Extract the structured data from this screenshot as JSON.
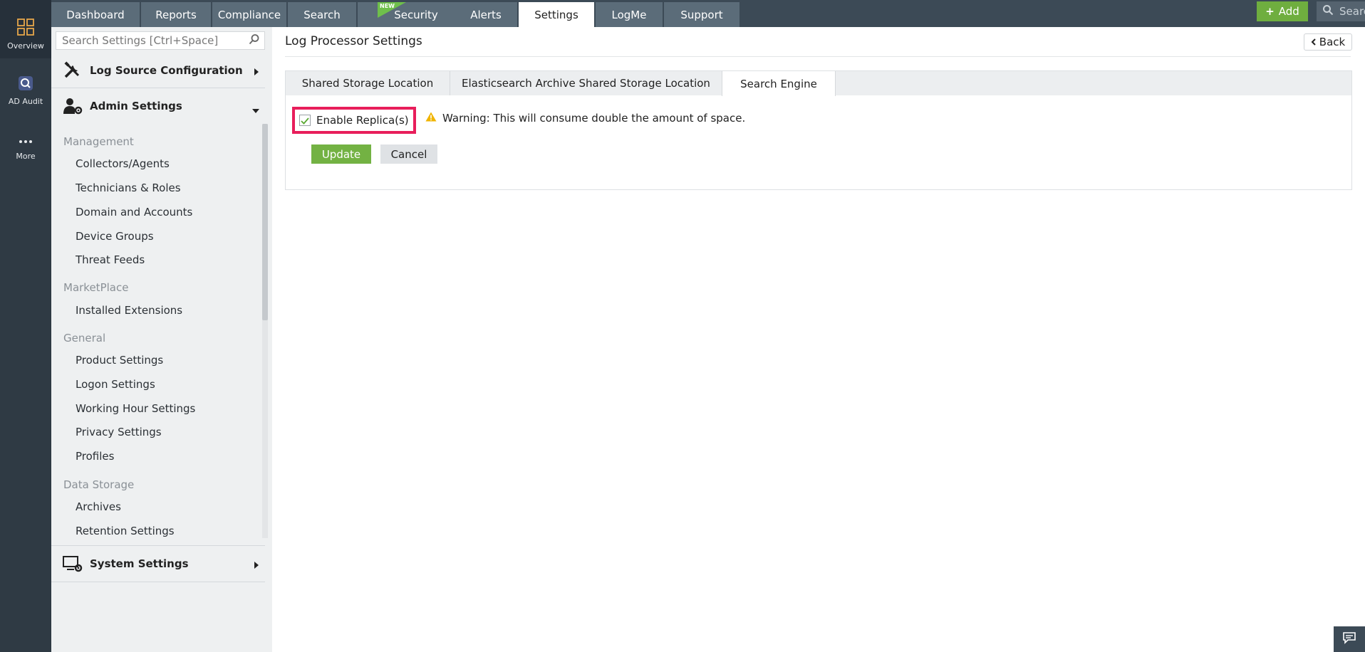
{
  "left_rail": {
    "items": [
      {
        "label": "Overview",
        "icon": "grid-icon"
      },
      {
        "label": "AD Audit",
        "icon": "ad-audit-icon"
      },
      {
        "label": "More",
        "icon": "more-icon"
      }
    ]
  },
  "top_nav": {
    "tabs": [
      {
        "label": "Dashboard"
      },
      {
        "label": "Reports"
      },
      {
        "label": "Compliance"
      },
      {
        "label": "Search"
      },
      {
        "label": "Security",
        "badge": "NEW"
      },
      {
        "label": "Alerts"
      },
      {
        "label": "Settings",
        "active": true
      },
      {
        "label": "LogMe"
      },
      {
        "label": "Support"
      }
    ],
    "add_label": "Add",
    "search_placeholder": "Search"
  },
  "sidebar": {
    "search_placeholder": "Search Settings [Ctrl+Space]",
    "sections": [
      {
        "label": "Log Source Configuration",
        "icon": "tools-icon",
        "expanded": false
      },
      {
        "label": "Admin Settings",
        "icon": "admin-gear-icon",
        "expanded": true
      },
      {
        "label": "System Settings",
        "icon": "monitor-gear-icon",
        "expanded": false
      }
    ],
    "groups": [
      {
        "label": "Management",
        "items": [
          "Collectors/Agents",
          "Technicians & Roles",
          "Domain and Accounts",
          "Device Groups",
          "Threat Feeds"
        ]
      },
      {
        "label": "MarketPlace",
        "items": [
          "Installed Extensions"
        ]
      },
      {
        "label": "General",
        "items": [
          "Product Settings",
          "Logon Settings",
          "Working Hour Settings",
          "Privacy Settings",
          "Profiles"
        ]
      },
      {
        "label": "Data Storage",
        "items": [
          "Archives",
          "Retention Settings"
        ]
      }
    ]
  },
  "main": {
    "title": "Log Processor Settings",
    "back_label": "Back",
    "tabs": [
      {
        "label": "Shared Storage Location"
      },
      {
        "label": "Elasticsearch Archive Shared Storage Location"
      },
      {
        "label": "Search Engine",
        "active": true
      }
    ],
    "replica": {
      "label": "Enable Replica(s)",
      "checked": true
    },
    "warning": "Warning: This will consume double the amount of space.",
    "update_label": "Update",
    "cancel_label": "Cancel"
  },
  "colors": {
    "rail_bg": "#2f3a44",
    "nav_bg": "#3c4a56",
    "nav_tab": "#5b6c79",
    "accent_green": "#73b243",
    "highlight": "#e81e5b",
    "warning": "#f0b400"
  }
}
